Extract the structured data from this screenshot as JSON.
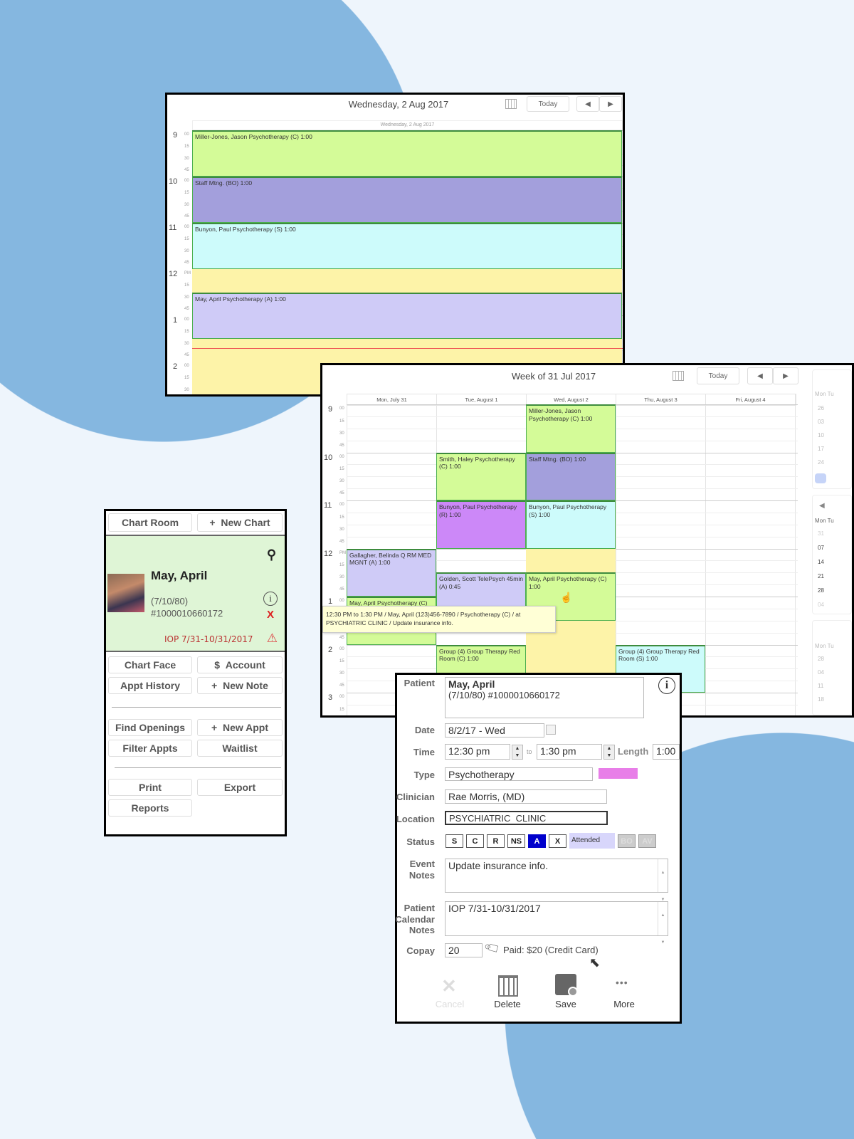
{
  "colors": {
    "background": "#eef5fc",
    "circle": "#85b7e0",
    "green": "#d4fb98",
    "purple": "#a39fdc",
    "cyan": "#cdfbfb",
    "lavender": "#cfcbf7",
    "violet": "#cc88f8",
    "yellow": "#fdf3a8",
    "tooltip": "#ffffd6",
    "attended_blue": "#0000cc",
    "type_swatch": "#e87ee8"
  },
  "day_view": {
    "title": "Wednesday, 2 Aug 2017",
    "subheader": "Wednesday, 2 Aug 2017",
    "today_label": "Today",
    "prev_icon": "triangle-left",
    "next_icon": "triangle-right",
    "calendar_icon": "calendar-grid",
    "hours": [
      {
        "h": "9",
        "m": "00"
      },
      {
        "h": "10",
        "m": "00"
      },
      {
        "h": "11",
        "m": "00"
      },
      {
        "h": "12",
        "m": "PM"
      },
      {
        "h": "1",
        "m": "00"
      },
      {
        "h": "2",
        "m": "00"
      }
    ],
    "quarters": [
      "15",
      "30",
      "45"
    ],
    "events": [
      {
        "label": "Miller-Jones, Jason Psychotherapy (C) 1:00",
        "start": "9:00",
        "end": "10:00",
        "color": "green"
      },
      {
        "label": "Staff Mtng. (BO) 1:00",
        "start": "10:00",
        "end": "11:00",
        "color": "purple"
      },
      {
        "label": "Bunyon, Paul Psychotherapy (S) 1:00",
        "start": "11:00",
        "end": "12:00",
        "color": "cyan"
      },
      {
        "label": "",
        "start": "12:00",
        "end": "12:30",
        "color": "yellow"
      },
      {
        "label": "May, April Psychotherapy (A) 1:00",
        "start": "12:30",
        "end": "13:30",
        "color": "lavender"
      },
      {
        "label": "",
        "start": "13:30",
        "end": "14:45",
        "color": "yellow"
      }
    ]
  },
  "week_view": {
    "title": "Week of 31 Jul 2017",
    "today_label": "Today",
    "days": [
      "Mon, July 31",
      "Tue, August 1",
      "Wed, August 2",
      "Thu, August 3",
      "Fri, August 4"
    ],
    "hours": [
      {
        "h": "9",
        "m": "00"
      },
      {
        "h": "10",
        "m": "00"
      },
      {
        "h": "11",
        "m": "00"
      },
      {
        "h": "12",
        "m": "PM"
      },
      {
        "h": "1",
        "m": "00"
      },
      {
        "h": "2",
        "m": "00"
      },
      {
        "h": "3",
        "m": "00"
      }
    ],
    "quarters": [
      "15",
      "30",
      "45"
    ],
    "events": [
      {
        "day": 2,
        "label": "",
        "start": "12:00",
        "end": "15:15",
        "color": "yellow",
        "plain": true
      },
      {
        "day": 2,
        "label": "Miller-Jones, Jason Psychotherapy (C) 1:00",
        "start": "9:00",
        "end": "10:00",
        "color": "green"
      },
      {
        "day": 1,
        "label": "Smith, Haley Psychotherapy (C) 1:00",
        "start": "10:00",
        "end": "11:00",
        "color": "green"
      },
      {
        "day": 2,
        "label": "Staff Mtng. (BO) 1:00",
        "start": "10:00",
        "end": "11:00",
        "color": "purple"
      },
      {
        "day": 1,
        "label": "Bunyon, Paul Psychotherapy (R) 1:00",
        "start": "11:00",
        "end": "12:00",
        "color": "violet"
      },
      {
        "day": 2,
        "label": "Bunyon, Paul Psychotherapy (S) 1:00",
        "start": "11:00",
        "end": "12:00",
        "color": "cyan"
      },
      {
        "day": 0,
        "label": "Gallagher, Belinda Q RM MED MGNT (A) 1:00",
        "start": "12:00",
        "end": "13:00",
        "color": "lavender"
      },
      {
        "day": 1,
        "label": "Golden, Scott TelePsych 45min (A) 0:45",
        "start": "12:30",
        "end": "13:15",
        "color": "lavender"
      },
      {
        "day": 2,
        "label": "May, April Psychotherapy (C) 1:00",
        "start": "12:30",
        "end": "13:30",
        "color": "green"
      },
      {
        "day": 0,
        "label": "May, April Psychotherapy (C)",
        "start": "13:00",
        "end": "14:00",
        "color": "green"
      },
      {
        "day": 1,
        "label": "Group (4) Group Therapy Red Room (C) 1:00",
        "start": "14:00",
        "end": "15:00",
        "color": "green"
      },
      {
        "day": 3,
        "label": "Group (4) Group Therapy Red Room (S) 1:00",
        "start": "14:00",
        "end": "15:00",
        "color": "cyan"
      }
    ],
    "tooltip": "12:30 PM to 1:30 PM / May, April (123)456-7890 / Psychotherapy (C) / at PSYCHIATRIC CLINIC / Update insurance info.",
    "mini_calendar": {
      "weekday_header": "Mon Tu",
      "rows_top": [
        "26",
        "03",
        "10",
        "17",
        "24"
      ],
      "rows_mid": [
        "31",
        "07",
        "14",
        "21",
        "28",
        "04"
      ],
      "rows_bottom": [
        "28",
        "04",
        "11",
        "18"
      ]
    }
  },
  "chart_panel": {
    "chart_room": "Chart Room",
    "new_chart": "New Chart",
    "patient_name": "May, April",
    "dob": "(7/10/80)",
    "id": "#1000010660172",
    "alert": "IOP 7/31-10/31/2017",
    "buttons": [
      "Chart Face",
      "Account",
      "Appt History",
      "New Note",
      "Find Openings",
      "New Appt",
      "Filter Appts",
      "Waitlist",
      "Print",
      "Export",
      "Reports"
    ]
  },
  "appt_form": {
    "labels": {
      "patient": "Patient",
      "date": "Date",
      "time": "Time",
      "to": "to",
      "length": "Length",
      "type": "Type",
      "clinician": "Clinician",
      "location": "Location",
      "status": "Status",
      "event_notes": "Event Notes",
      "patient_calendar_notes": "Patient Calendar Notes",
      "copay": "Copay"
    },
    "patient_name": "May, April",
    "patient_detail": "(7/10/80) #1000010660172",
    "date": "8/2/17 - Wed",
    "start_time": "12:30 pm",
    "end_time": "1:30 pm",
    "length": "1:00",
    "type": "Psychotherapy",
    "clinician": "Rae Morris, (MD)",
    "location": "PSYCHIATRIC  CLINIC",
    "status_buttons": [
      "S",
      "C",
      "R",
      "NS",
      "A",
      "X"
    ],
    "status_selected": "A",
    "status_text": "Attended",
    "disabled_status": [
      "BO",
      "AV"
    ],
    "event_notes": "Update insurance info.",
    "calendar_notes": "IOP 7/31-10/31/2017",
    "copay": "20",
    "paid": "Paid: $20 (Credit Card)",
    "actions": [
      "Cancel",
      "Delete",
      "Save",
      "More"
    ]
  }
}
